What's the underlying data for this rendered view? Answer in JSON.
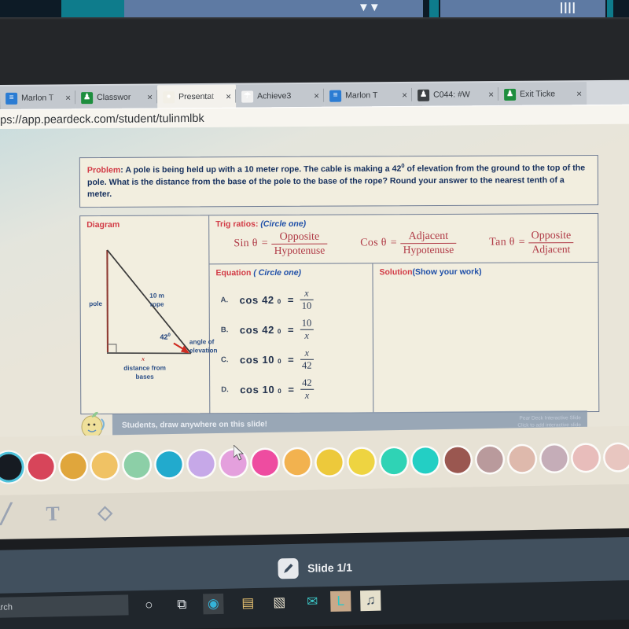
{
  "browser": {
    "url": "tps://app.peardeck.com/student/tulinmlbk",
    "tabs": [
      {
        "title": "Marlon T",
        "favicon": "docs-icon",
        "favicon_glyph": "≡",
        "favicon_color": "#2b7cd3",
        "active": false,
        "close": "×"
      },
      {
        "title": "Classwor",
        "favicon": "classroom-icon",
        "favicon_glyph": "♟",
        "favicon_color": "#1e8e3e",
        "active": false,
        "close": "×"
      },
      {
        "title": "Presentat",
        "favicon": "peardeck-icon",
        "favicon_glyph": "●",
        "favicon_color": "#f2efe6",
        "active": true,
        "close": "×"
      },
      {
        "title": "Achieve3",
        "favicon": "achieve-icon",
        "favicon_glyph": "☂",
        "favicon_color": "#f1f1f1",
        "active": false,
        "close": "×"
      },
      {
        "title": "Marlon T",
        "favicon": "docs-icon",
        "favicon_glyph": "≡",
        "favicon_color": "#2b7cd3",
        "active": false,
        "close": "×"
      },
      {
        "title": "C044: #W",
        "favicon": "contact-icon",
        "favicon_glyph": "♟",
        "favicon_color": "#3c4043",
        "active": false,
        "close": "×"
      },
      {
        "title": "Exit Ticke",
        "favicon": "classroom-icon",
        "favicon_glyph": "♟",
        "favicon_color": "#1e8e3e",
        "active": false,
        "close": "×"
      }
    ]
  },
  "worksheet": {
    "problem": {
      "label": "Problem",
      "text": ": A pole is being held up with a 10 meter rope. The cable  is making a 42",
      "degree": "0",
      "text2": " of elevation from the ground to the top of the pole. What is the distance from the base of the pole to the base of the rope? Round your answer to the nearest tenth of a meter."
    },
    "diagram": {
      "heading": "Diagram",
      "pole_label": "pole",
      "rope_label_1": "10 m",
      "rope_label_2": "rope",
      "angle_label": "42",
      "angle_degree": "0",
      "angle_of": "angle of",
      "elevation": "elevation",
      "x_label": "x",
      "base_label_1": "distance from",
      "base_label_2": "bases"
    },
    "trig": {
      "heading": "Trig ratios: ",
      "instruction": "(Circle one)",
      "ratios": [
        {
          "fn": "Sin θ",
          "eq": "=",
          "num": "Opposite",
          "den": "Hypotenuse"
        },
        {
          "fn": "Cos θ",
          "eq": "=",
          "num": "Adjacent",
          "den": "Hypotenuse"
        },
        {
          "fn": "Tan θ",
          "eq": "=",
          "num": "Opposite",
          "den": "Adjacent"
        }
      ]
    },
    "equation": {
      "heading": "Equation ",
      "instruction": "( Circle one)",
      "choices": [
        {
          "letter": "A.",
          "fn": "cos 42",
          "deg": "0",
          "eq": "=",
          "num": "x",
          "num_italic": true,
          "den": "10",
          "den_italic": false
        },
        {
          "letter": "B.",
          "fn": "cos 42",
          "deg": "0",
          "eq": "=",
          "num": "10",
          "num_italic": false,
          "den": "x",
          "den_italic": true
        },
        {
          "letter": "C.",
          "fn": "cos 10",
          "deg": "0",
          "eq": "=",
          "num": "x",
          "num_italic": true,
          "den": "42",
          "den_italic": false
        },
        {
          "letter": "D.",
          "fn": "cos 10",
          "deg": "0",
          "eq": "=",
          "num": "42",
          "num_italic": false,
          "den": "x",
          "den_italic": true
        }
      ]
    },
    "solution": {
      "heading": "Solution",
      "sub": "(Show your work)"
    }
  },
  "peardeck": {
    "draw_prompt": "Students, draw anywhere on this slide!",
    "brand_line1": "Pear Deck Interactive Slide",
    "brand_line2": "Click to add interactive slide"
  },
  "palette": {
    "selected_index": 0,
    "colors": [
      "#161b22",
      "#d7455a",
      "#e0a63c",
      "#f0c264",
      "#8ccfa7",
      "#22aacd",
      "#c6a8e8",
      "#e4a0dd",
      "#ee4ca0",
      "#f2b24f",
      "#edc93b",
      "#eed441",
      "#2fd3b5",
      "#23cfc4",
      "#9a5750",
      "#b99a9c",
      "#deb9ac",
      "#c5adb8",
      "#e8bdbb",
      "#e8c6c0"
    ]
  },
  "tools": [
    {
      "name": "pen-tool",
      "glyph": "╱"
    },
    {
      "name": "text-tool",
      "glyph": "T"
    },
    {
      "name": "eraser-tool",
      "glyph": "◇"
    }
  ],
  "slide_bar": {
    "label": "Slide 1/1",
    "icon": "marker-icon",
    "icon_glyph": "✎"
  },
  "taskbar": {
    "search_placeholder": "earch",
    "items": [
      {
        "name": "cortana-icon",
        "glyph": "○",
        "color": "#dfe3e7",
        "bg": "transparent"
      },
      {
        "name": "task-view-icon",
        "glyph": "⧉",
        "color": "#dfe3e7",
        "bg": "transparent"
      },
      {
        "name": "edge-icon",
        "glyph": "◉",
        "color": "#34b3d8",
        "bg": "highlight"
      },
      {
        "name": "file-explorer-icon",
        "glyph": "▤",
        "color": "#e8c271",
        "bg": "transparent"
      },
      {
        "name": "microsoft-store-icon",
        "glyph": "▧",
        "color": "#e9e2cf",
        "bg": "transparent"
      },
      {
        "name": "mail-icon",
        "glyph": "✉",
        "color": "#3cc6c6",
        "bg": "transparent"
      },
      {
        "name": "app-l-icon",
        "glyph": "L",
        "color": "#29c7c7",
        "bg": "#c8a98a"
      },
      {
        "name": "app-media-icon",
        "glyph": "♫",
        "color": "#3a4a5a",
        "bg": "#e6e0cc"
      }
    ]
  }
}
